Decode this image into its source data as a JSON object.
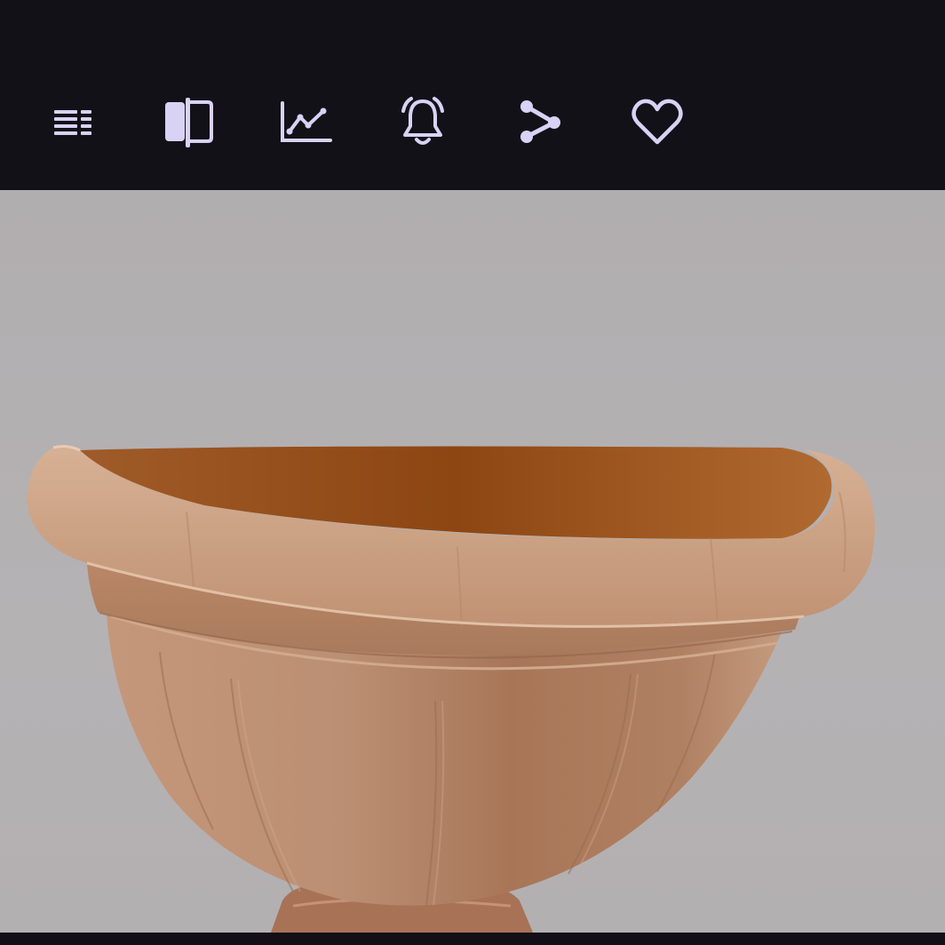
{
  "toolbar": {
    "buttons": [
      {
        "icon": "list-icon",
        "label": "List"
      },
      {
        "icon": "compare-icon",
        "label": "Compare"
      },
      {
        "icon": "chart-icon",
        "label": "Price history"
      },
      {
        "icon": "bell-icon",
        "label": "Price alert"
      },
      {
        "icon": "share-icon",
        "label": "Share"
      },
      {
        "icon": "heart-icon",
        "label": "Favorite"
      }
    ],
    "icon_color": "#d8d2f4",
    "background": "#131118"
  },
  "viewer": {
    "image": "terracotta-half-round-wall-planter",
    "background": "#b2afb1"
  }
}
